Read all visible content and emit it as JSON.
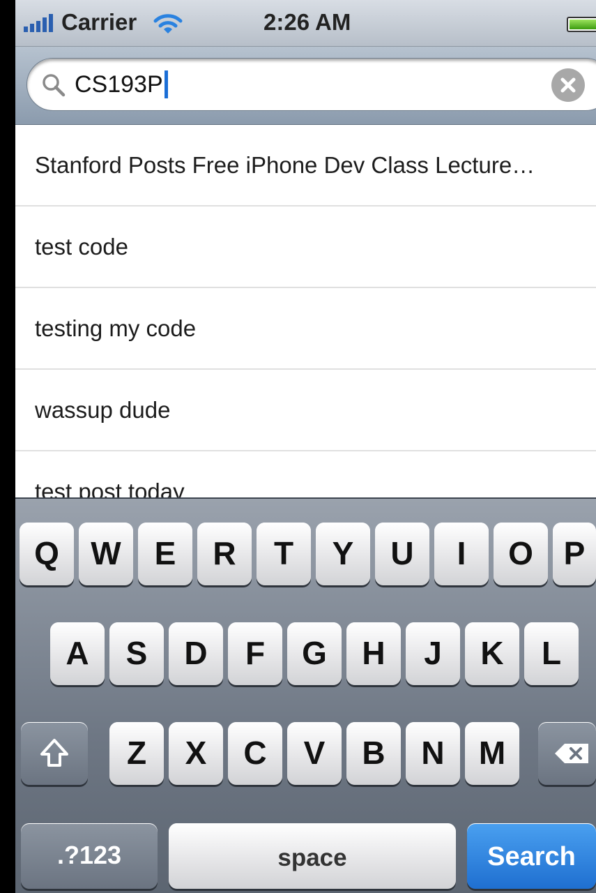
{
  "status_bar": {
    "carrier": "Carrier",
    "time": "2:26 AM"
  },
  "search": {
    "value": "CS193P"
  },
  "results": [
    "Stanford Posts Free iPhone Dev Class Lecture…",
    "test code",
    "testing my code",
    "wassup dude",
    "test post today"
  ],
  "keyboard": {
    "row1": [
      "Q",
      "W",
      "E",
      "R",
      "T",
      "Y",
      "U",
      "I",
      "O",
      "P"
    ],
    "row2": [
      "A",
      "S",
      "D",
      "F",
      "G",
      "H",
      "J",
      "K",
      "L"
    ],
    "row3": [
      "Z",
      "X",
      "C",
      "V",
      "B",
      "N",
      "M"
    ],
    "numbers_label": ".?123",
    "space_label": "space",
    "search_label": "Search"
  },
  "colors": {
    "search_key": "#1f6fd0",
    "cursor": "#1b6ed6"
  }
}
